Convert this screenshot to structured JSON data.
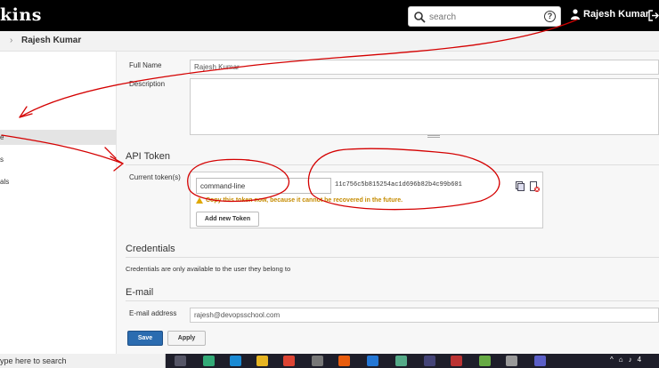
{
  "header": {
    "logo_text": "kins",
    "search_placeholder": "search",
    "help_label": "?",
    "user_name": "Rajesh Kumar"
  },
  "breadcrumb": {
    "items": [
      "Rajesh Kumar"
    ]
  },
  "sidebar": {
    "items": [
      {
        "label": "e"
      },
      {
        "label": "s"
      },
      {
        "label": "als"
      }
    ]
  },
  "form": {
    "full_name_label": "Full Name",
    "full_name_value": "Rajesh Kumar",
    "description_label": "Description",
    "api_token_title": "API Token",
    "current_tokens_label": "Current token(s)",
    "token_name": "command-line",
    "token_value": "11c756c5b815254ac1d696b82b4c99b601",
    "token_warning": "Copy this token now, because it cannot be recovered in the future.",
    "add_token_label": "Add new Token",
    "credentials_title": "Credentials",
    "credentials_desc": "Credentials are only available to the user they belong to",
    "email_title": "E-mail",
    "email_label": "E-mail address",
    "email_value": "rajesh@devopsschool.com",
    "save_label": "Save",
    "apply_label": "Apply"
  },
  "taskbar": {
    "search_text": "ype here to search",
    "clock_partial": "4"
  },
  "colors": {
    "header_bg": "#000000",
    "primary_button": "#2b6cb0",
    "warning_text": "#c58b00",
    "annotation_red": "#d40000"
  },
  "icons": [
    "search-icon",
    "help-icon",
    "user-icon",
    "logout-icon",
    "copy-icon",
    "revoke-icon",
    "warning-icon",
    "windows-taskbar-icons"
  ]
}
